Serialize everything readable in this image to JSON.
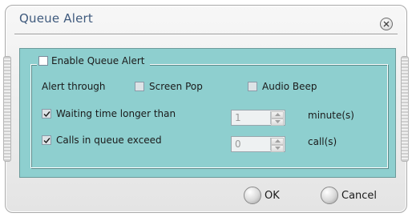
{
  "window": {
    "title": "Queue Alert",
    "close_icon": "close-icon"
  },
  "group": {
    "enable_label": "Enable Queue Alert",
    "enable_checked": false
  },
  "alert_through": {
    "label": "Alert through",
    "options": [
      {
        "label": "Screen Pop",
        "checked": false
      },
      {
        "label": "Audio Beep",
        "checked": false
      }
    ]
  },
  "waiting_time": {
    "label": "Waiting time longer than",
    "checked": true,
    "value": "1",
    "unit": "minute(s)"
  },
  "calls_in_queue": {
    "label": "Calls in queue exceed",
    "checked": true,
    "value": "0",
    "unit": "call(s)"
  },
  "buttons": {
    "ok_label": "OK",
    "cancel_label": "Cancel"
  },
  "colors": {
    "title": "#3f5a7d",
    "content_bg": "#8ecfcf"
  }
}
